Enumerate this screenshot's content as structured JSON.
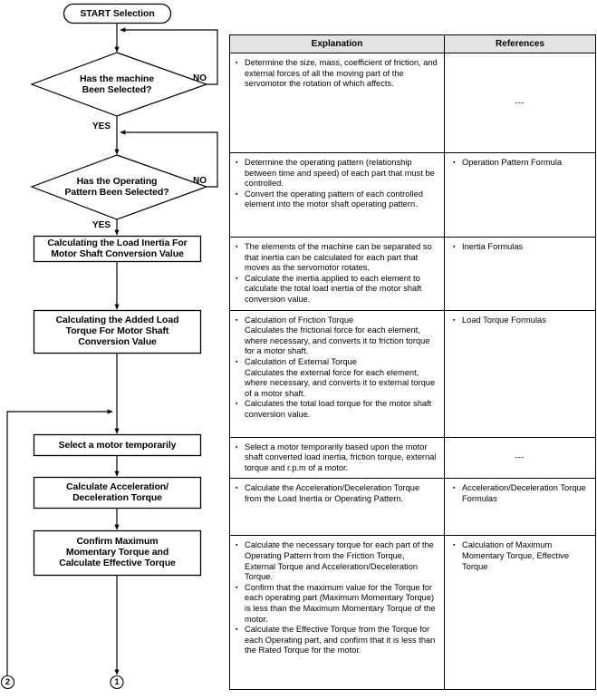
{
  "flowchart": {
    "start": "START Selection",
    "decisions": [
      {
        "line1": "Has the machine",
        "line2": "Been Selected?",
        "no_label": "NO",
        "yes_label": "YES"
      },
      {
        "line1": "Has the Operating",
        "line2": "Pattern Been Selected?",
        "no_label": "NO",
        "yes_label": "YES"
      }
    ],
    "processes": [
      {
        "lines": [
          "Calculating the Load Inertia For",
          "Motor Shaft Conversion Value"
        ]
      },
      {
        "lines": [
          "Calculating the Added Load",
          "Torque For Motor Shaft",
          "Conversion Value"
        ]
      },
      {
        "lines": [
          "Select a motor temporarily"
        ]
      },
      {
        "lines": [
          "Calculate Acceleration/",
          "Deceleration Torque"
        ]
      },
      {
        "lines": [
          "Confirm Maximum",
          "Momentary Torque and",
          "Calculate Effective Torque"
        ]
      }
    ],
    "connectors": [
      {
        "id": "2"
      },
      {
        "id": "1"
      }
    ]
  },
  "table": {
    "headers": {
      "explanation": "Explanation",
      "references": "References"
    },
    "rows": [
      {
        "explanation": [
          {
            "text": "Determine the size, mass, coefficient of friction, and external forces of all the moving part of the servomotor the rotation of which affects."
          }
        ],
        "references": [],
        "references_dash": "---"
      },
      {
        "explanation": [
          {
            "text": "Determine the operating pattern (relationship between time and speed) of each part that must be controlled."
          },
          {
            "text": "Convert the operating pattern of each controlled element into the motor shaft operating pattern."
          }
        ],
        "references": [
          {
            "text": "Operation Pattern Formula"
          }
        ]
      },
      {
        "explanation": [
          {
            "text": "The elements of the machine can be separated so that inertia can be calculated for each part that moves as the servomotor rotates."
          },
          {
            "text": "Calculate the inertia applied to each element to calculate the total load inertia of the motor shaft conversion value."
          }
        ],
        "references": [
          {
            "text": "Inertia Formulas"
          }
        ]
      },
      {
        "explanation": [
          {
            "text": "Calculation of Friction Torque",
            "sub": "Calculates the frictional force for each element, where necessary, and converts it to friction torque for a motor shaft."
          },
          {
            "text": "Calculation of External Torque",
            "sub": "Calculates the external force for each element, where necessary, and converts it to external torque of a motor shaft."
          },
          {
            "text": "Calculates the total load torque for the motor shaft conversion value."
          }
        ],
        "references": [
          {
            "text": "Load Torque Formulas"
          }
        ]
      },
      {
        "explanation": [
          {
            "text": "Select a motor temporarily based upon the motor shaft converted load inertia, friction torque, external torque and r.p.m of a motor."
          }
        ],
        "references": [],
        "references_dash": "---"
      },
      {
        "explanation": [
          {
            "text": "Calculate the Acceleration/Deceleration Torque from the Load Inertia or Operating Pattern."
          }
        ],
        "references": [
          {
            "text": "Acceleration/Deceleration Torque Formulas"
          }
        ]
      },
      {
        "explanation": [
          {
            "text": "Calculate the necessary torque for each part of the Operating Pattern from the Friction Torque, External Torque and Acceleration/Deceleration Torque."
          },
          {
            "text": "Confirm that the maximum value for the Torque for each operating part (Maximum Momentary Torque) is less than the Maximum Momentary Torque of the motor."
          },
          {
            "text": "Calculate the Effective Torque from the Torque for each Operating part, and confirm that it is less than the Rated Torque for the motor."
          }
        ],
        "references": [
          {
            "text": "Calculation of Maximum Momentary Torque, Effective Torque"
          }
        ]
      }
    ]
  }
}
